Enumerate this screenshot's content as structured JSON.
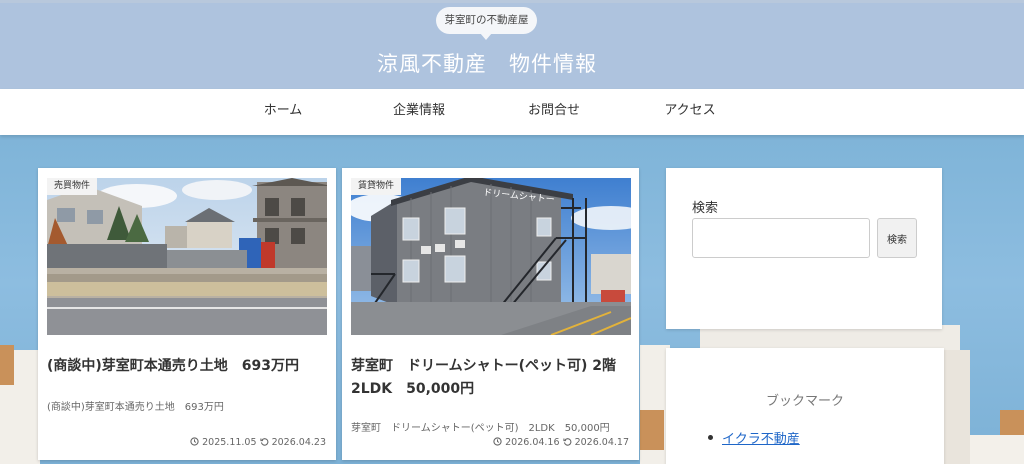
{
  "header": {
    "tagline": "芽室町の不動産屋",
    "site_title": "涼風不動産　物件情報"
  },
  "nav": {
    "items": [
      {
        "label": "ホーム"
      },
      {
        "label": "企業情報"
      },
      {
        "label": "お問合せ"
      },
      {
        "label": "アクセス"
      }
    ]
  },
  "posts": [
    {
      "category": "売買物件",
      "title": "(商談中)芽室町本通売り土地　693万円",
      "snippet": "(商談中)芽室町本通売り土地　693万円",
      "published": "2025.11.05",
      "updated": "2026.04.23"
    },
    {
      "category": "賃貸物件",
      "title": "芽室町　ドリームシャトー(ペット可) 2階 2LDK　50,000円",
      "snippet": "芽室町　ドリームシャトー(ペット可)　2LDK　50,000円",
      "published": "2026.04.16",
      "updated": "2026.04.17",
      "sign_text": "ドリームシャトー"
    }
  ],
  "sidebar": {
    "search": {
      "title": "検索",
      "placeholder": "",
      "button_label": "検索"
    },
    "bookmarks": {
      "title": "ブックマーク",
      "items": [
        {
          "label": "イクラ不動産"
        }
      ]
    }
  },
  "colors": {
    "header_bg": "#aec3de",
    "link": "#1e66c8",
    "sky_background": "#8dbde0"
  }
}
